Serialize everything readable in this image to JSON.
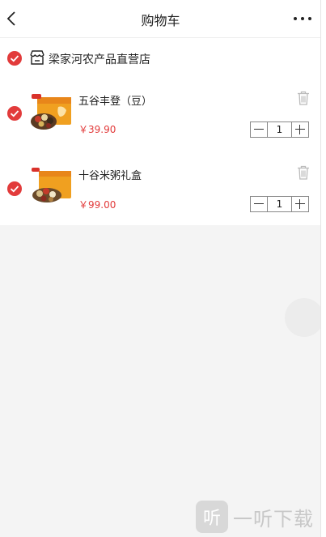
{
  "header": {
    "title": "购物车"
  },
  "store": {
    "name": "梁家河农产品直营店",
    "checked": true
  },
  "items": [
    {
      "name": "五谷丰登（豆）",
      "price": "￥39.90",
      "quantity": "1",
      "checked": true
    },
    {
      "name": "十谷米粥礼盒",
      "price": "￥99.00",
      "quantity": "1",
      "checked": true
    }
  ],
  "watermark": {
    "logo_glyph": "听",
    "text": "一听下载"
  },
  "colors": {
    "accent": "#e23b3b",
    "background": "#f4f4f4",
    "card": "#ffffff"
  },
  "icons": [
    "back-arrow-icon",
    "more-dots-icon",
    "check-circle-icon",
    "store-icon",
    "trash-icon",
    "minus-icon",
    "plus-icon"
  ]
}
